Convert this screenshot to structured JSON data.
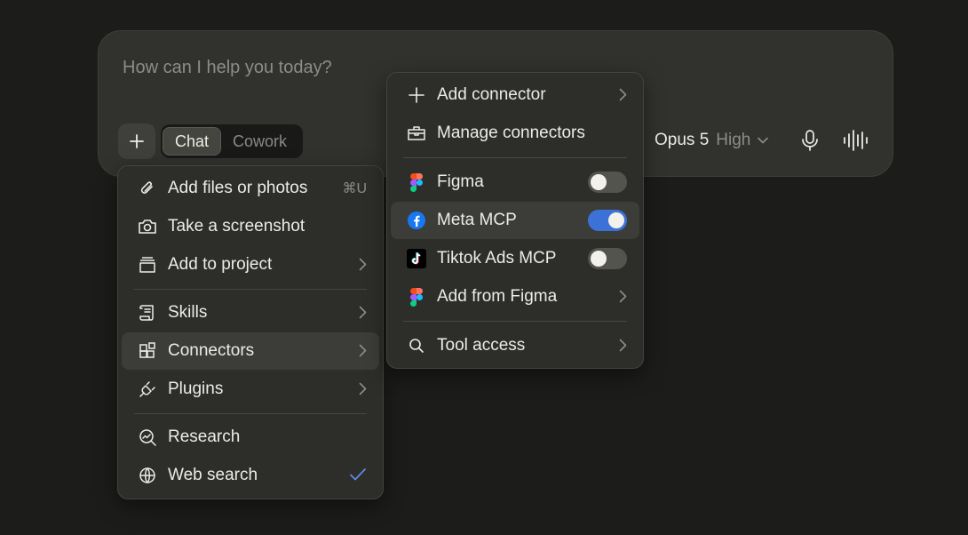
{
  "composer": {
    "placeholder": "How can I help you today?",
    "modes": [
      "Chat",
      "Cowork"
    ],
    "active_mode": "Chat",
    "model": "Opus 5",
    "effort": "High"
  },
  "attach_menu": {
    "items": [
      {
        "label": "Add files or photos",
        "icon": "paperclip-icon",
        "shortcut": "⌘U"
      },
      {
        "label": "Take a screenshot",
        "icon": "camera-icon"
      },
      {
        "label": "Add to project",
        "icon": "project-box-icon",
        "submenu": true
      },
      {
        "label": "Skills",
        "icon": "scroll-icon",
        "submenu": true
      },
      {
        "label": "Connectors",
        "icon": "connectors-icon",
        "submenu": true,
        "highlighted": true
      },
      {
        "label": "Plugins",
        "icon": "plug-icon",
        "submenu": true
      },
      {
        "label": "Research",
        "icon": "research-icon"
      },
      {
        "label": "Web search",
        "icon": "globe-icon",
        "checked": true
      }
    ]
  },
  "connectors_menu": {
    "items": [
      {
        "label": "Add connector",
        "icon": "plus-icon",
        "submenu": true
      },
      {
        "label": "Manage connectors",
        "icon": "toolbox-icon"
      },
      {
        "label": "Figma",
        "icon": "figma-icon",
        "enabled": false
      },
      {
        "label": "Meta MCP",
        "icon": "facebook-icon",
        "enabled": true,
        "highlighted": true
      },
      {
        "label": "Tiktok Ads MCP",
        "icon": "tiktok-icon",
        "enabled": false
      },
      {
        "label": "Add from Figma",
        "icon": "figma-icon",
        "submenu": true
      },
      {
        "label": "Tool access",
        "icon": "search-icon",
        "submenu": true
      }
    ]
  },
  "colors": {
    "accent": "#3c72d8",
    "surface": "#31312e",
    "menu": "#2d2d2a"
  }
}
